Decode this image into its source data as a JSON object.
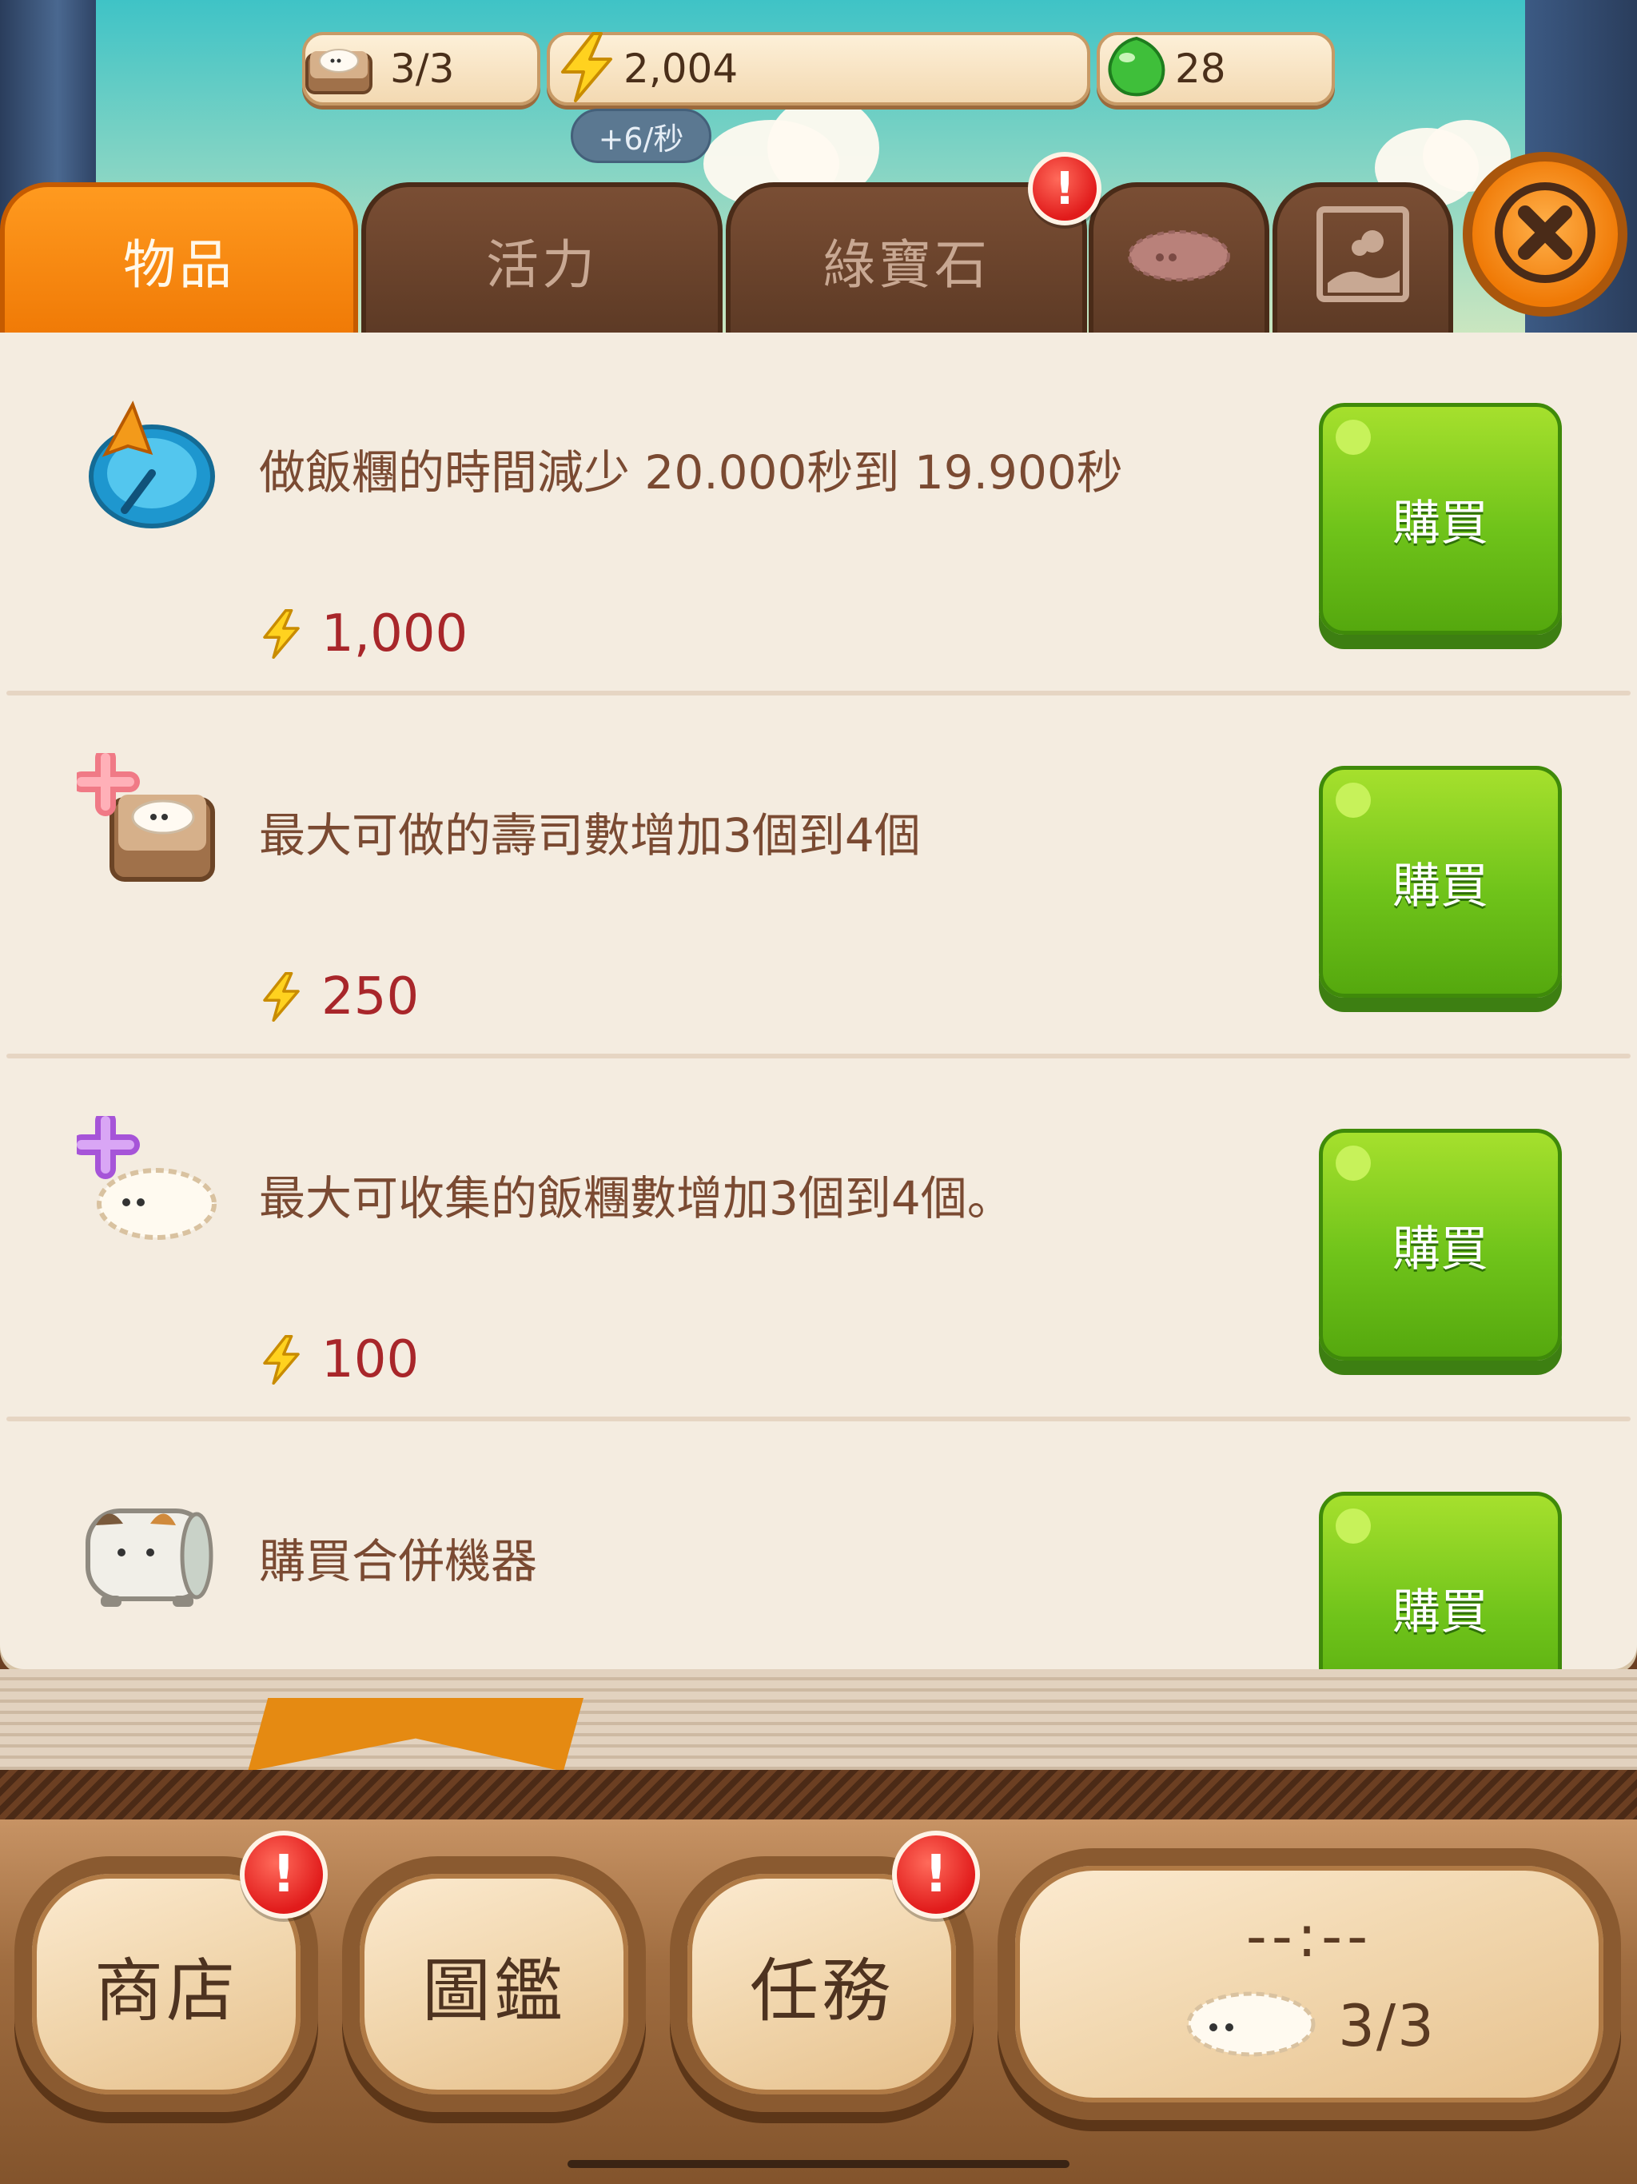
{
  "resources": {
    "sushi_capacity": "3/3",
    "energy": "2,004",
    "energy_rate": "+6/秒",
    "gems": "28"
  },
  "tabs": [
    {
      "label": "物品",
      "active": true
    },
    {
      "label": "活力",
      "active": false
    },
    {
      "label": "綠寶石",
      "active": false
    },
    {
      "icon": "sushi-tab-icon",
      "active": false
    },
    {
      "icon": "picture-frame-icon",
      "active": false
    }
  ],
  "items": [
    {
      "description": "做飯糰的時間減少 20.000秒到 19.900秒",
      "price": "1,000",
      "buy_label": "購買",
      "icon": "clock-compass-icon"
    },
    {
      "description": "最大可做的壽司數增加3個到4個",
      "price": "250",
      "buy_label": "購買",
      "icon": "plus-sushi-board-icon"
    },
    {
      "description": "最大可收集的飯糰數增加3個到4個。",
      "price": "100",
      "buy_label": "購買",
      "icon": "plus-rice-ball-icon"
    },
    {
      "description": "購買合併機器",
      "buy_label": "購買",
      "icon": "cat-machine-icon"
    }
  ],
  "bottom_nav": {
    "shop": "商店",
    "catalog": "圖鑑",
    "tasks": "任務",
    "timer": "--:--",
    "rice_count": "3/3"
  },
  "badges": {
    "alert_symbol": "!"
  },
  "colors": {
    "active_tab": "#f07a06",
    "buy_button": "#6fc31a",
    "price_text": "#a8262a",
    "badge_red": "#e11b1b"
  }
}
